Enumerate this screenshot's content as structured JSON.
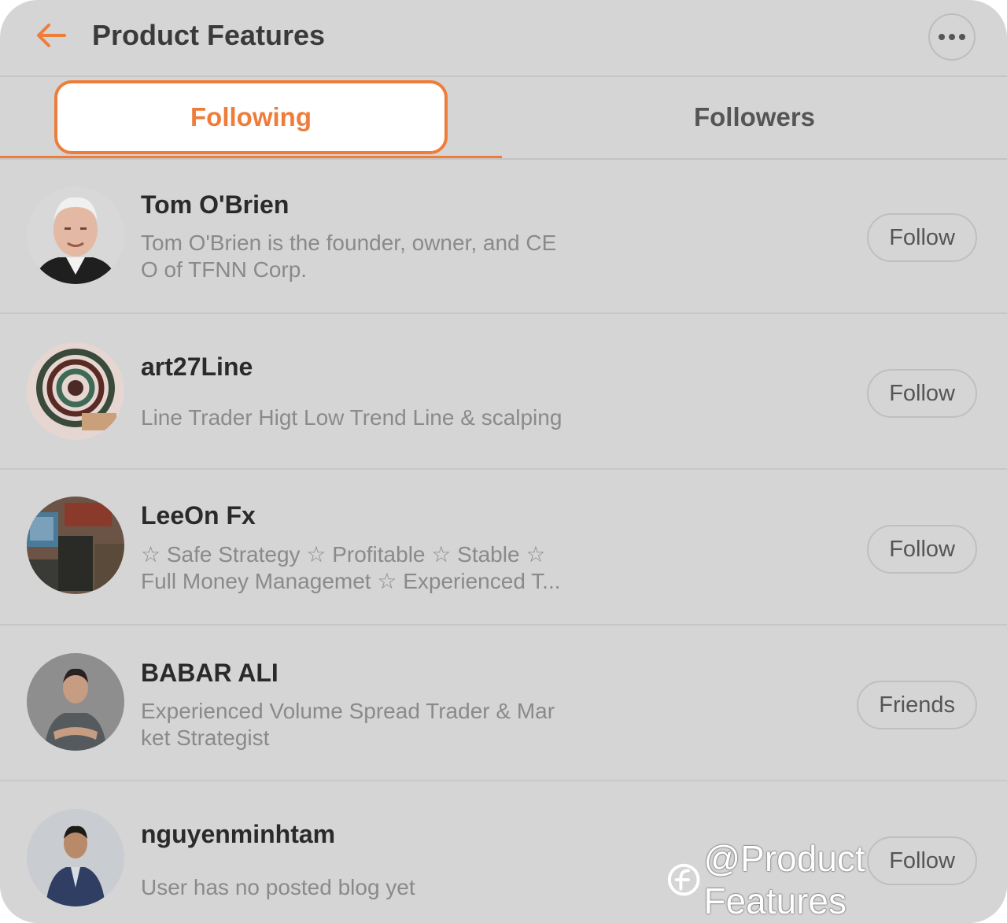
{
  "header": {
    "title": "Product Features",
    "back_icon": "arrow-left-icon",
    "more_icon": "more-horizontal-icon"
  },
  "tabs": [
    {
      "label": "Following",
      "active": true
    },
    {
      "label": "Followers",
      "active": false
    }
  ],
  "colors": {
    "accent": "#ee7d3a",
    "background": "#d5d5d5",
    "text": "#2a2a2a",
    "muted": "#8a8a8a"
  },
  "users": [
    {
      "name": "Tom O'Brien",
      "bio_line1": "Tom O'Brien is the founder, owner, and CE",
      "bio_line2": "O of TFNN Corp.",
      "action": "Follow"
    },
    {
      "name": "art27Line",
      "bio_line1": "Line Trader Higt Low Trend Line & scalping",
      "bio_line2": "",
      "action": "Follow"
    },
    {
      "name": "LeeOn Fx",
      "bio_line1": "☆ Safe Strategy ☆ Profitable ☆ Stable ☆",
      "bio_line2": "Full Money Managemet ☆ Experienced T...",
      "action": "Follow"
    },
    {
      "name": "BABAR ALI",
      "bio_line1": "Experienced Volume Spread Trader & Mar",
      "bio_line2": "ket Strategist",
      "action": "Friends"
    },
    {
      "name": "nguyenminhtam",
      "bio_line1": "User has no posted blog yet",
      "bio_line2": "",
      "action": "Follow"
    }
  ],
  "watermark": {
    "text": "@Product Features",
    "icon": "brand-logo-icon"
  }
}
